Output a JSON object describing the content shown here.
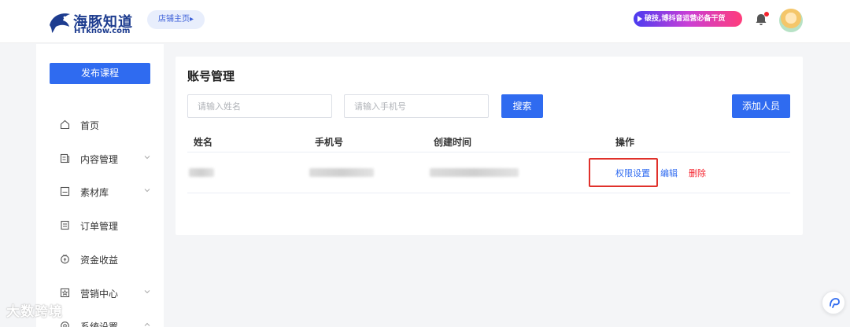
{
  "header": {
    "brand": "海豚知道",
    "brand_sub": "HTknow.com",
    "store_link": "店铺主页▸",
    "promo": "破技,博抖音运营必备干货"
  },
  "sidebar": {
    "publish": "发布课程",
    "items": [
      {
        "label": "首页",
        "icon": "home-icon",
        "expand": false
      },
      {
        "label": "内容管理",
        "icon": "content-icon",
        "expand": true
      },
      {
        "label": "素材库",
        "icon": "folder-icon",
        "expand": true
      },
      {
        "label": "订单管理",
        "icon": "order-icon",
        "expand": false
      },
      {
        "label": "资金收益",
        "icon": "money-icon",
        "expand": false
      },
      {
        "label": "营销中心",
        "icon": "marketing-icon",
        "expand": true
      },
      {
        "label": "系统设置",
        "icon": "settings-icon",
        "expand": true
      }
    ]
  },
  "main": {
    "title": "账号管理",
    "name_placeholder": "请输入姓名",
    "phone_placeholder": "请输入手机号",
    "search": "搜索",
    "add": "添加人员",
    "columns": [
      "姓名",
      "手机号",
      "创建时间",
      "操作"
    ],
    "rows": [
      {
        "actions": {
          "permission": "权限设置",
          "edit": "编辑",
          "delete": "删除"
        }
      }
    ]
  },
  "watermark": "大数跨境",
  "colors": {
    "primary": "#2f6bf0",
    "danger": "#f5222d",
    "highlight": "#e0312b"
  }
}
